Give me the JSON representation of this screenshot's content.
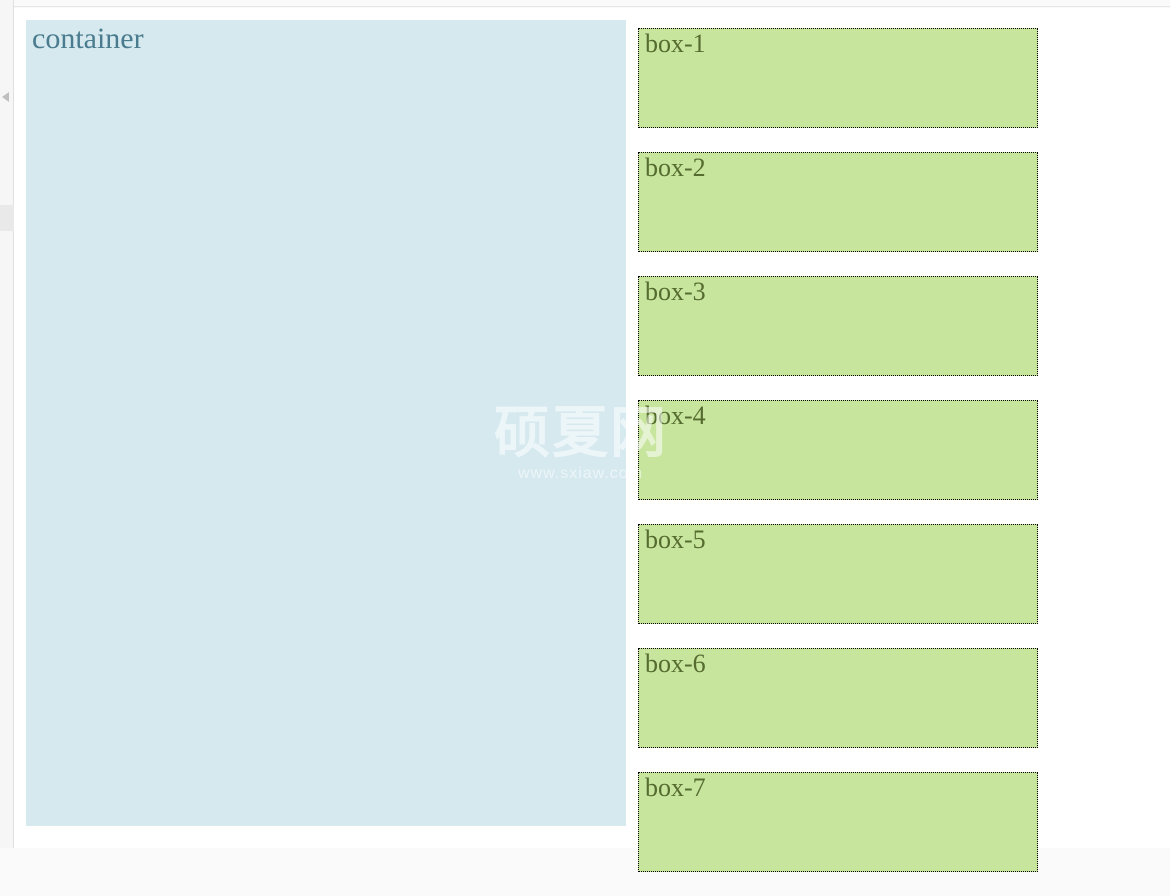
{
  "container": {
    "label": "container"
  },
  "boxes": [
    {
      "label": "box-1"
    },
    {
      "label": "box-2"
    },
    {
      "label": "box-3"
    },
    {
      "label": "box-4"
    },
    {
      "label": "box-5"
    },
    {
      "label": "box-6"
    },
    {
      "label": "box-7"
    }
  ],
  "watermark": {
    "main": "硕夏网",
    "sub": "www.sxiaw.com"
  }
}
